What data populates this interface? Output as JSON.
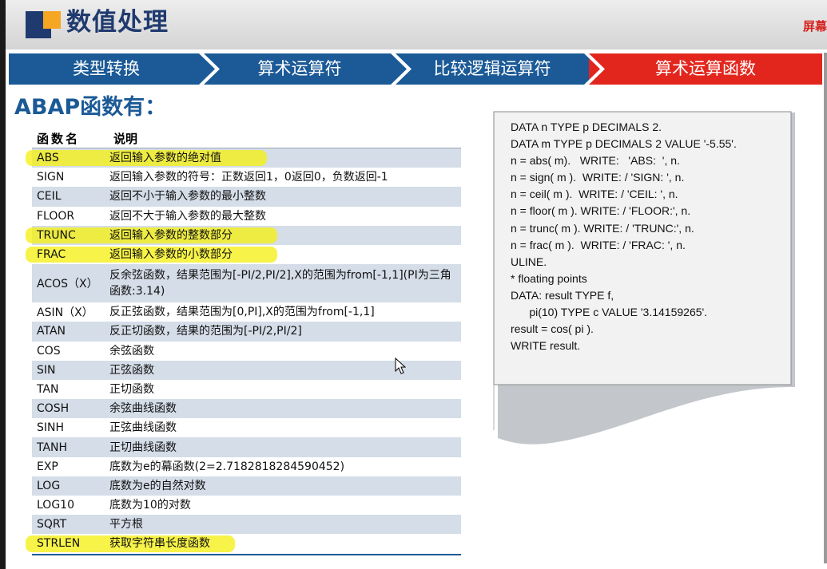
{
  "header": {
    "title": "数值处理",
    "screen_label": "屏幕"
  },
  "nav": [
    {
      "label": "类型转换",
      "active": false
    },
    {
      "label": "算术运算符",
      "active": false
    },
    {
      "label": "比较逻辑运算符",
      "active": false
    },
    {
      "label": "算术运算函数",
      "active": true
    }
  ],
  "main": {
    "heading": "ABAP函数有："
  },
  "table": {
    "headers": [
      "函数名",
      "说明"
    ],
    "rows": [
      {
        "name": "ABS",
        "desc": "返回输入参数的绝对值",
        "highlight": true
      },
      {
        "name": "SIGN",
        "desc": "返回输入参数的符号：正数返回1，0返回0，负数返回-1",
        "highlight": false
      },
      {
        "name": "CEIL",
        "desc": "返回不小于输入参数的最小整数",
        "highlight": false
      },
      {
        "name": "FLOOR",
        "desc": "返回不大于输入参数的最大整数",
        "highlight": false
      },
      {
        "name": "TRUNC",
        "desc": "返回输入参数的整数部分",
        "highlight": true
      },
      {
        "name": "FRAC",
        "desc": "返回输入参数的小数部分",
        "highlight": true
      },
      {
        "name": "ACOS（X）",
        "desc": "反余弦函数，结果范围为[-PI/2,PI/2],X的范围为from[-1,1](PI为三角函数:3.14)",
        "highlight": false
      },
      {
        "name": "ASIN（X）",
        "desc": "反正弦函数，结果范围为[0,PI],X的范围为from[-1,1]",
        "highlight": false
      },
      {
        "name": "ATAN",
        "desc": "反正切函数，结果的范围为[-PI/2,PI/2]",
        "highlight": false
      },
      {
        "name": "COS",
        "desc": "余弦函数",
        "highlight": false
      },
      {
        "name": "SIN",
        "desc": "正弦函数",
        "highlight": false
      },
      {
        "name": "TAN",
        "desc": "正切函数",
        "highlight": false
      },
      {
        "name": "COSH",
        "desc": "余弦曲线函数",
        "highlight": false
      },
      {
        "name": "SINH",
        "desc": "正弦曲线函数",
        "highlight": false
      },
      {
        "name": "TANH",
        "desc": "正切曲线函数",
        "highlight": false
      },
      {
        "name": "EXP",
        "desc": "底数为e的幕函数(2=2.7182818284590452)",
        "highlight": false
      },
      {
        "name": "LOG",
        "desc": "底数为e的自然对数",
        "highlight": false
      },
      {
        "name": "LOG10",
        "desc": "底数为10的对数",
        "highlight": false
      },
      {
        "name": "SQRT",
        "desc": "平方根",
        "highlight": false
      },
      {
        "name": "STRLEN",
        "desc": "获取字符串长度函数",
        "highlight": true
      }
    ]
  },
  "code": {
    "lines": [
      "DATA n TYPE p DECIMALS 2.",
      "DATA m TYPE p DECIMALS 2 VALUE '-5.55'.",
      "n = abs( m).   WRITE:   'ABS:  ', n.",
      "n = sign( m ).  WRITE: / 'SIGN: ', n.",
      "n = ceil( m ).  WRITE: / 'CEIL: ', n.",
      "n = floor( m ). WRITE: / 'FLOOR:', n.",
      "n = trunc( m ). WRITE: / 'TRUNC:', n.",
      "n = frac( m ).  WRITE: / 'FRAC: ', n.",
      "ULINE.",
      "* floating points",
      "DATA: result TYPE f,",
      "      pi(10) TYPE c VALUE '3.14159265'.",
      "result = cos( pi ).",
      "WRITE result."
    ]
  },
  "colors": {
    "navy": "#1f3a6e",
    "nav_blue": "#1b5a96",
    "nav_active": "#e3261d",
    "row_stripe": "#d4dde8",
    "highlight": "#f5f014"
  }
}
